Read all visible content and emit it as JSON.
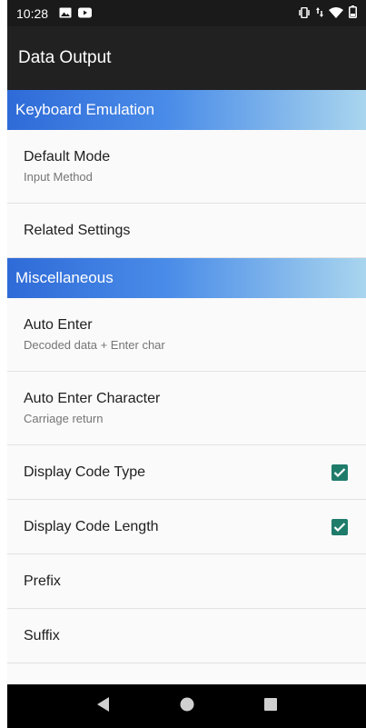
{
  "status_bar": {
    "time": "10:28",
    "left_icons": [
      "image-icon",
      "youtube-icon"
    ],
    "right_icons": [
      "vibrate-icon",
      "data-arrows-icon",
      "wifi-icon",
      "battery-icon"
    ]
  },
  "toolbar": {
    "title": "Data Output"
  },
  "sections": {
    "keyboard": {
      "title": "Keyboard Emulation",
      "default_mode": {
        "title": "Default Mode",
        "summary": "Input Method"
      },
      "related_settings": {
        "title": "Related Settings"
      }
    },
    "misc": {
      "title": "Miscellaneous",
      "auto_enter": {
        "title": "Auto Enter",
        "summary": "Decoded data + Enter char"
      },
      "auto_enter_char": {
        "title": "Auto Enter Character",
        "summary": "Carriage return"
      },
      "display_code_type": {
        "title": "Display Code Type",
        "checked": true
      },
      "display_code_length": {
        "title": "Display Code Length",
        "checked": true
      },
      "prefix": {
        "title": "Prefix"
      },
      "suffix": {
        "title": "Suffix"
      }
    }
  },
  "nav_bar": {
    "buttons": [
      "back-icon",
      "home-icon",
      "recents-icon"
    ]
  },
  "colors": {
    "accent_checkbox": "#1f7c6b",
    "header_gradient_start": "#2f6bd8",
    "header_gradient_end": "#a9d5ee",
    "toolbar_bg": "#212121"
  }
}
